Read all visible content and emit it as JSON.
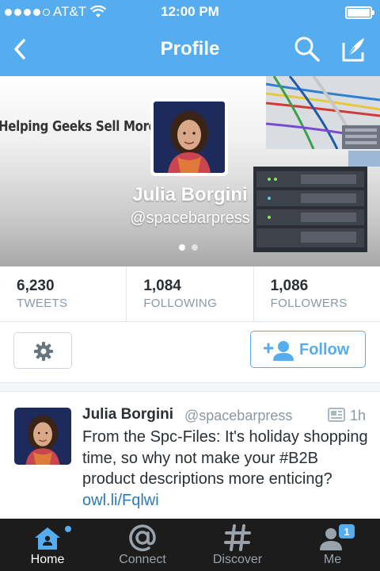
{
  "status_bar": {
    "carrier": "AT&T",
    "time": "12:00 PM"
  },
  "nav": {
    "title": "Profile"
  },
  "profile": {
    "banner_tagline": "Helping Geeks Sell More Stuff",
    "name": "Julia Borgini",
    "handle": "@spacebarpress"
  },
  "stats": [
    {
      "value": "6,230",
      "label": "TWEETS"
    },
    {
      "value": "1,084",
      "label": "FOLLOWING"
    },
    {
      "value": "1,086",
      "label": "FOLLOWERS"
    }
  ],
  "actions": {
    "follow_label": "Follow"
  },
  "tweet": {
    "name": "Julia Borgini",
    "handle": "@spacebarpress",
    "time": "1h",
    "text": "From the Spc-Files: It's holiday shopping time, so why not make your #B2B product descriptions more enticing?",
    "link": "owl.li/Fqlwi"
  },
  "tabs": [
    {
      "label": "Home",
      "icon": "home-icon",
      "active": true
    },
    {
      "label": "Connect",
      "icon": "at-icon",
      "active": false
    },
    {
      "label": "Discover",
      "icon": "hashtag-icon",
      "active": false
    },
    {
      "label": "Me",
      "icon": "person-icon",
      "active": false,
      "badge": "1"
    }
  ],
  "colors": {
    "brand_blue": "#55acee",
    "tabbar": "#1c1c1c",
    "link": "#2b7bb9",
    "muted": "#8899a6"
  }
}
